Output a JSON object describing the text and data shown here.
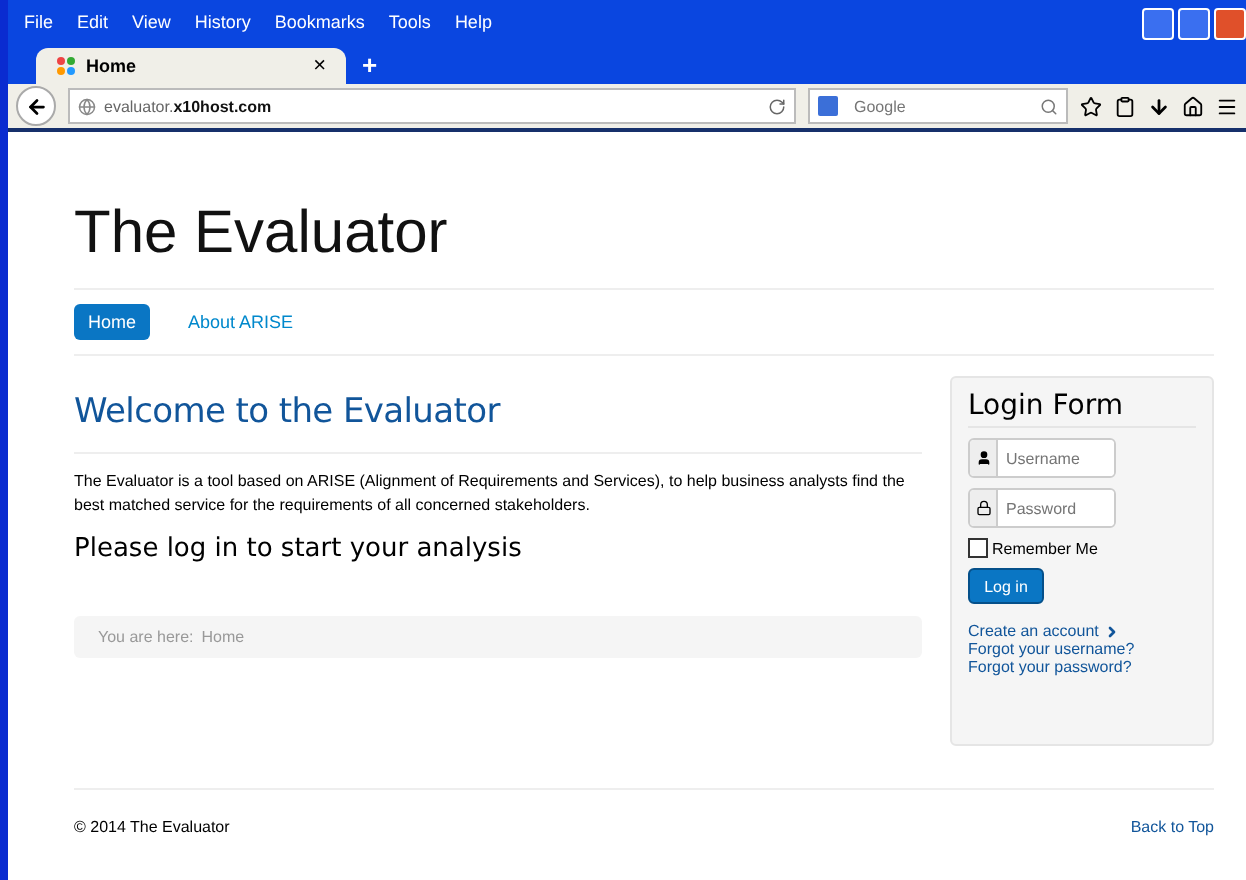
{
  "browser": {
    "menu": [
      "File",
      "Edit",
      "View",
      "History",
      "Bookmarks",
      "Tools",
      "Help"
    ],
    "tab": {
      "title": "Home",
      "close": "×",
      "new_tab": "+"
    },
    "address": {
      "host": "evaluator.",
      "domain": "x10host.com"
    },
    "search": {
      "placeholder": "Google"
    }
  },
  "site": {
    "title": "The Evaluator",
    "nav": [
      {
        "label": "Home",
        "selected": true
      },
      {
        "label": "About ARISE",
        "selected": false
      }
    ],
    "heading": "Welcome to the Evaluator",
    "intro": "The Evaluator is a tool based on ARISE (Alignment of Requirements and Services), to help business analysts find the best matched service for the requirements of all concerned stakeholders.",
    "subheading": "Please log in to start your analysis",
    "breadcrumb": {
      "label": "You are here:",
      "current": "Home"
    },
    "login": {
      "title": "Login Form",
      "username": {
        "placeholder": "Username"
      },
      "password": {
        "placeholder": "Password"
      },
      "remember": {
        "label": "Remember Me",
        "checked": false
      },
      "button": "Log in",
      "links": [
        "Create an account",
        "Forgot your username?",
        "Forgot your password?"
      ]
    },
    "footer": {
      "copyright": "© 2014 The Evaluator",
      "back_to_top": "Back to Top"
    }
  }
}
